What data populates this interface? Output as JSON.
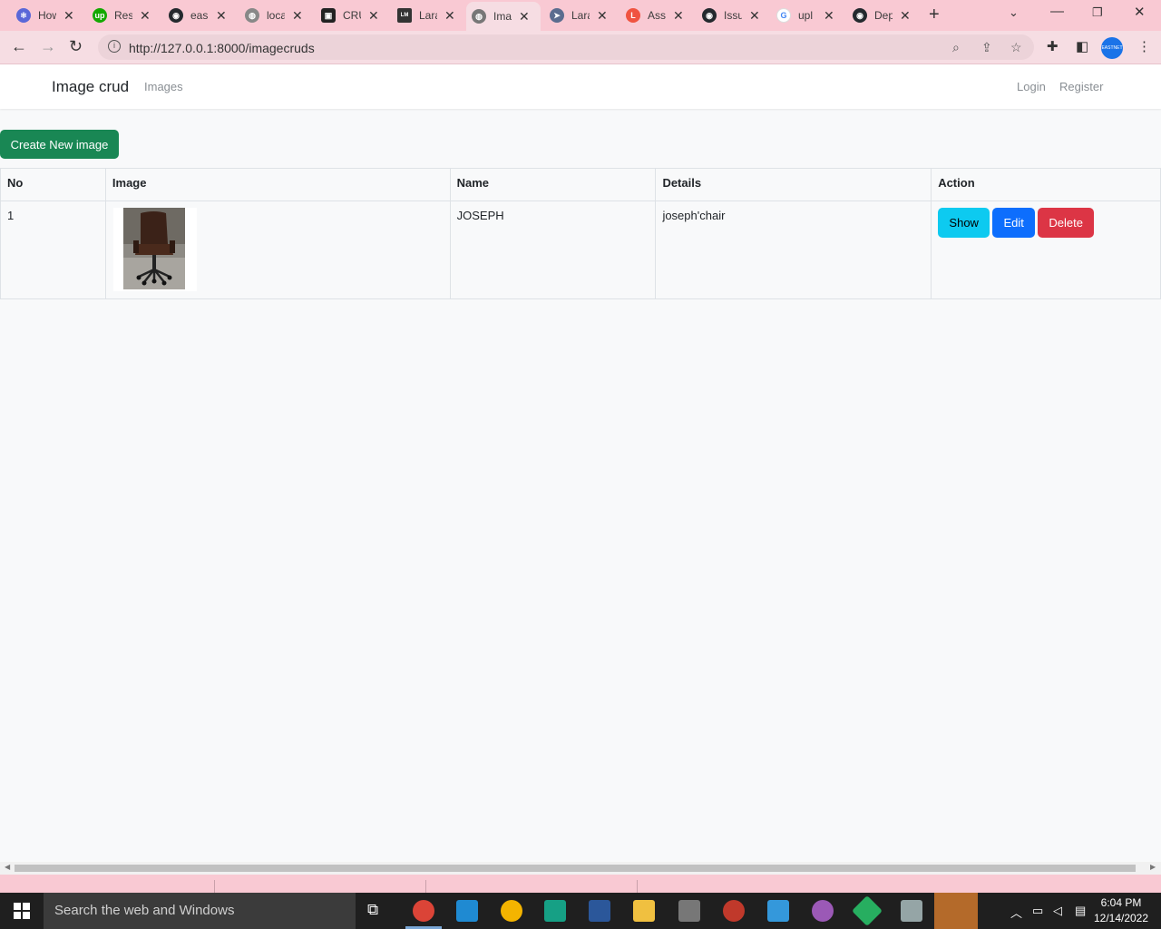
{
  "browser": {
    "tabs": [
      {
        "label": "How",
        "icon": "react-icon",
        "color": "#5a67d8"
      },
      {
        "label": "Res",
        "icon": "upwork-icon",
        "color": "#14a800"
      },
      {
        "label": "eas",
        "icon": "github-icon",
        "color": "#24292e"
      },
      {
        "label": "loca",
        "icon": "globe-icon",
        "color": "#888888"
      },
      {
        "label": "CRU",
        "icon": "crud-icon",
        "color": "#222222"
      },
      {
        "label": "Lara",
        "icon": "laravel-icon",
        "color": "#333333"
      },
      {
        "label": "Ima",
        "icon": "globe-icon",
        "color": "#777777",
        "active": true
      },
      {
        "label": "Lara",
        "icon": "send-icon",
        "color": "#5b6c8f"
      },
      {
        "label": "Ass",
        "icon": "laravel-icon",
        "color": "#f05340"
      },
      {
        "label": "Issu",
        "icon": "github-icon",
        "color": "#24292e"
      },
      {
        "label": "upl",
        "icon": "google-icon",
        "color": "#4285f4"
      },
      {
        "label": "Dep",
        "icon": "github-icon",
        "color": "#24292e"
      }
    ],
    "url": "http://127.0.0.1:8000/imagecruds",
    "profile_label": "EASTNET"
  },
  "app": {
    "brand": "Image crud",
    "nav_images": "Images",
    "nav_login": "Login",
    "nav_register": "Register",
    "create_button": "Create New image",
    "columns": [
      "No",
      "Image",
      "Name",
      "Details",
      "Action"
    ],
    "rows": [
      {
        "no": "1",
        "name": "JOSEPH",
        "details": "joseph'chair",
        "image": "chair-thumbnail"
      }
    ],
    "actions": {
      "show": "Show",
      "edit": "Edit",
      "delete": "Delete"
    }
  },
  "taskbar": {
    "search_placeholder": "Search the web and Windows",
    "time": "6:04 PM",
    "date": "12/14/2022"
  },
  "colors": {
    "success": "#198754",
    "info": "#0dcaf0",
    "primary": "#0d6efd",
    "danger": "#dc3545",
    "chrome_tint": "#f9c9d3"
  }
}
